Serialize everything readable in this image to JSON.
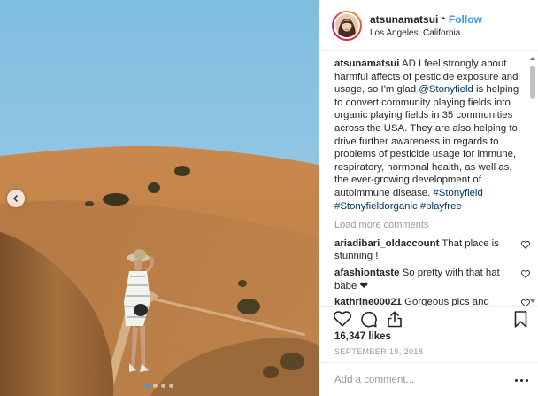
{
  "post": {
    "username": "atsunamatsui",
    "separator": "•",
    "follow_label": "Follow",
    "location": "Los Angeles, California",
    "caption": {
      "username": "atsunamatsui",
      "text_1": " AD I feel strongly about harmful affects of pesticide exposure and usage, so I'm glad ",
      "mention": "@Stonyfield",
      "text_2": " is helping to convert community playing fields into organic playing fields in 35 communities across the USA. They are also helping to drive further awareness in regards to problems of pesticide usage for immune, respiratory, hormonal health, as well as, the ever-growing development of autoimmune disease. ",
      "hashtags": [
        "#Stonyfield",
        "#Stonyfieldorganic",
        "#playfree"
      ]
    },
    "load_more_label": "Load more comments",
    "comments": [
      {
        "username": "ariadibari_oldaccount",
        "text": " That place is stunning !"
      },
      {
        "username": "afashiontaste",
        "text": " So pretty with that hat babe ❤"
      },
      {
        "username": "kathrine00021",
        "text": " Gorgeous pics and thanks for sharing this company!"
      }
    ],
    "likes": "16,347 likes",
    "date": "SEPTEMBER 19, 2018",
    "add_comment_placeholder": "Add a comment...",
    "carousel": {
      "total": 4,
      "active_index": 0
    }
  },
  "icons": {
    "heart": "heart-icon",
    "comment": "comment-icon",
    "share": "share-icon",
    "bookmark": "bookmark-icon",
    "prev": "chevron-left-icon",
    "more": "more-options-icon"
  },
  "colors": {
    "accent": "#3897f0",
    "link": "#003569",
    "muted": "#999999",
    "text": "#262626"
  }
}
